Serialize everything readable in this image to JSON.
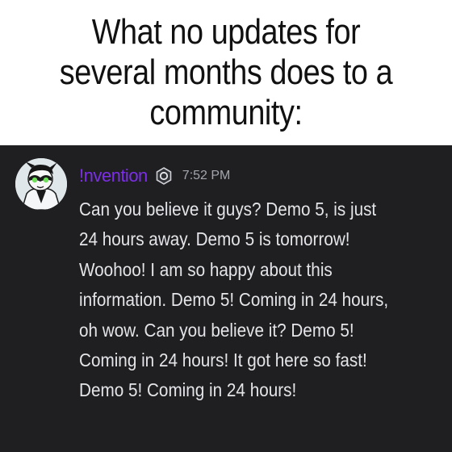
{
  "caption": {
    "lines": [
      "What no updates for",
      "several months does to a",
      "community:"
    ]
  },
  "message": {
    "author": "!nvention",
    "author_color": "#7b2ee6",
    "badge_icon": "server-tag-badge-icon",
    "timestamp": "7:52 PM",
    "avatar_icon": "character-avatar-icon",
    "lines": [
      "Can you believe it guys? Demo 5, is just",
      "24 hours away. Demo 5 is tomorrow!",
      "Woohoo! I am so happy about this",
      "information. Demo 5! Coming in 24 hours,",
      "oh wow. Can you believe it? Demo 5!",
      "Coming in 24 hours! It got here so fast!",
      "Demo 5! Coming in 24 hours!"
    ]
  },
  "colors": {
    "panel_background": "#1f1f22",
    "message_text": "#e4e5e8",
    "timestamp_text": "#a3a6ad"
  }
}
